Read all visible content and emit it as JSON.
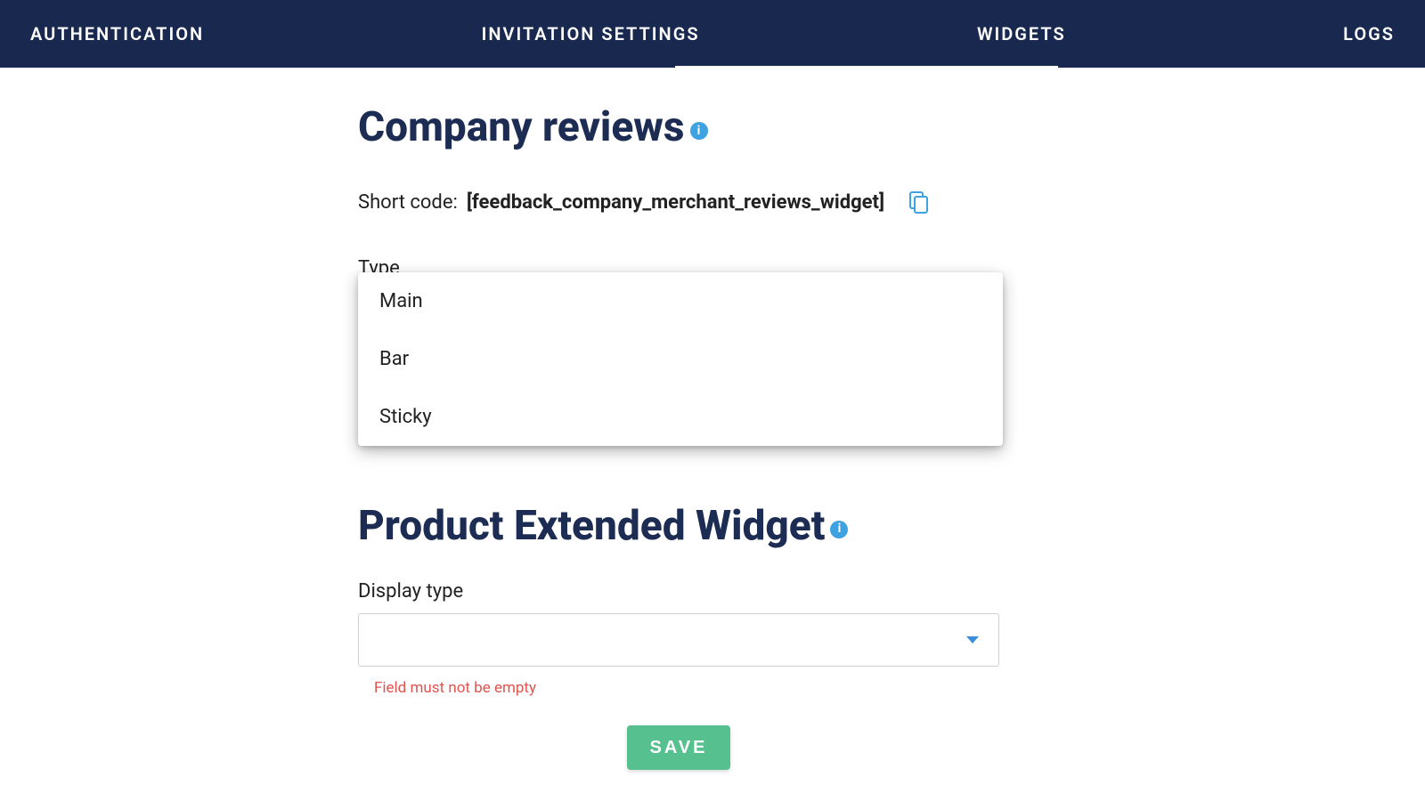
{
  "nav": {
    "tabs": [
      "AUTHENTICATION",
      "INVITATION SETTINGS",
      "WIDGETS",
      "LOGS"
    ],
    "active_index": 2
  },
  "company_reviews": {
    "title": "Company reviews",
    "shortcode_label": "Short code:",
    "shortcode_value": "[feedback_company_merchant_reviews_widget]",
    "type_label": "Type",
    "type_options": [
      "Main",
      "Bar",
      "Sticky"
    ]
  },
  "product_extended": {
    "title": "Product Extended Widget",
    "display_type_label": "Display type",
    "display_type_value": "",
    "error": "Field must not be empty"
  },
  "actions": {
    "save": "SAVE"
  },
  "info_icon_char": "i"
}
